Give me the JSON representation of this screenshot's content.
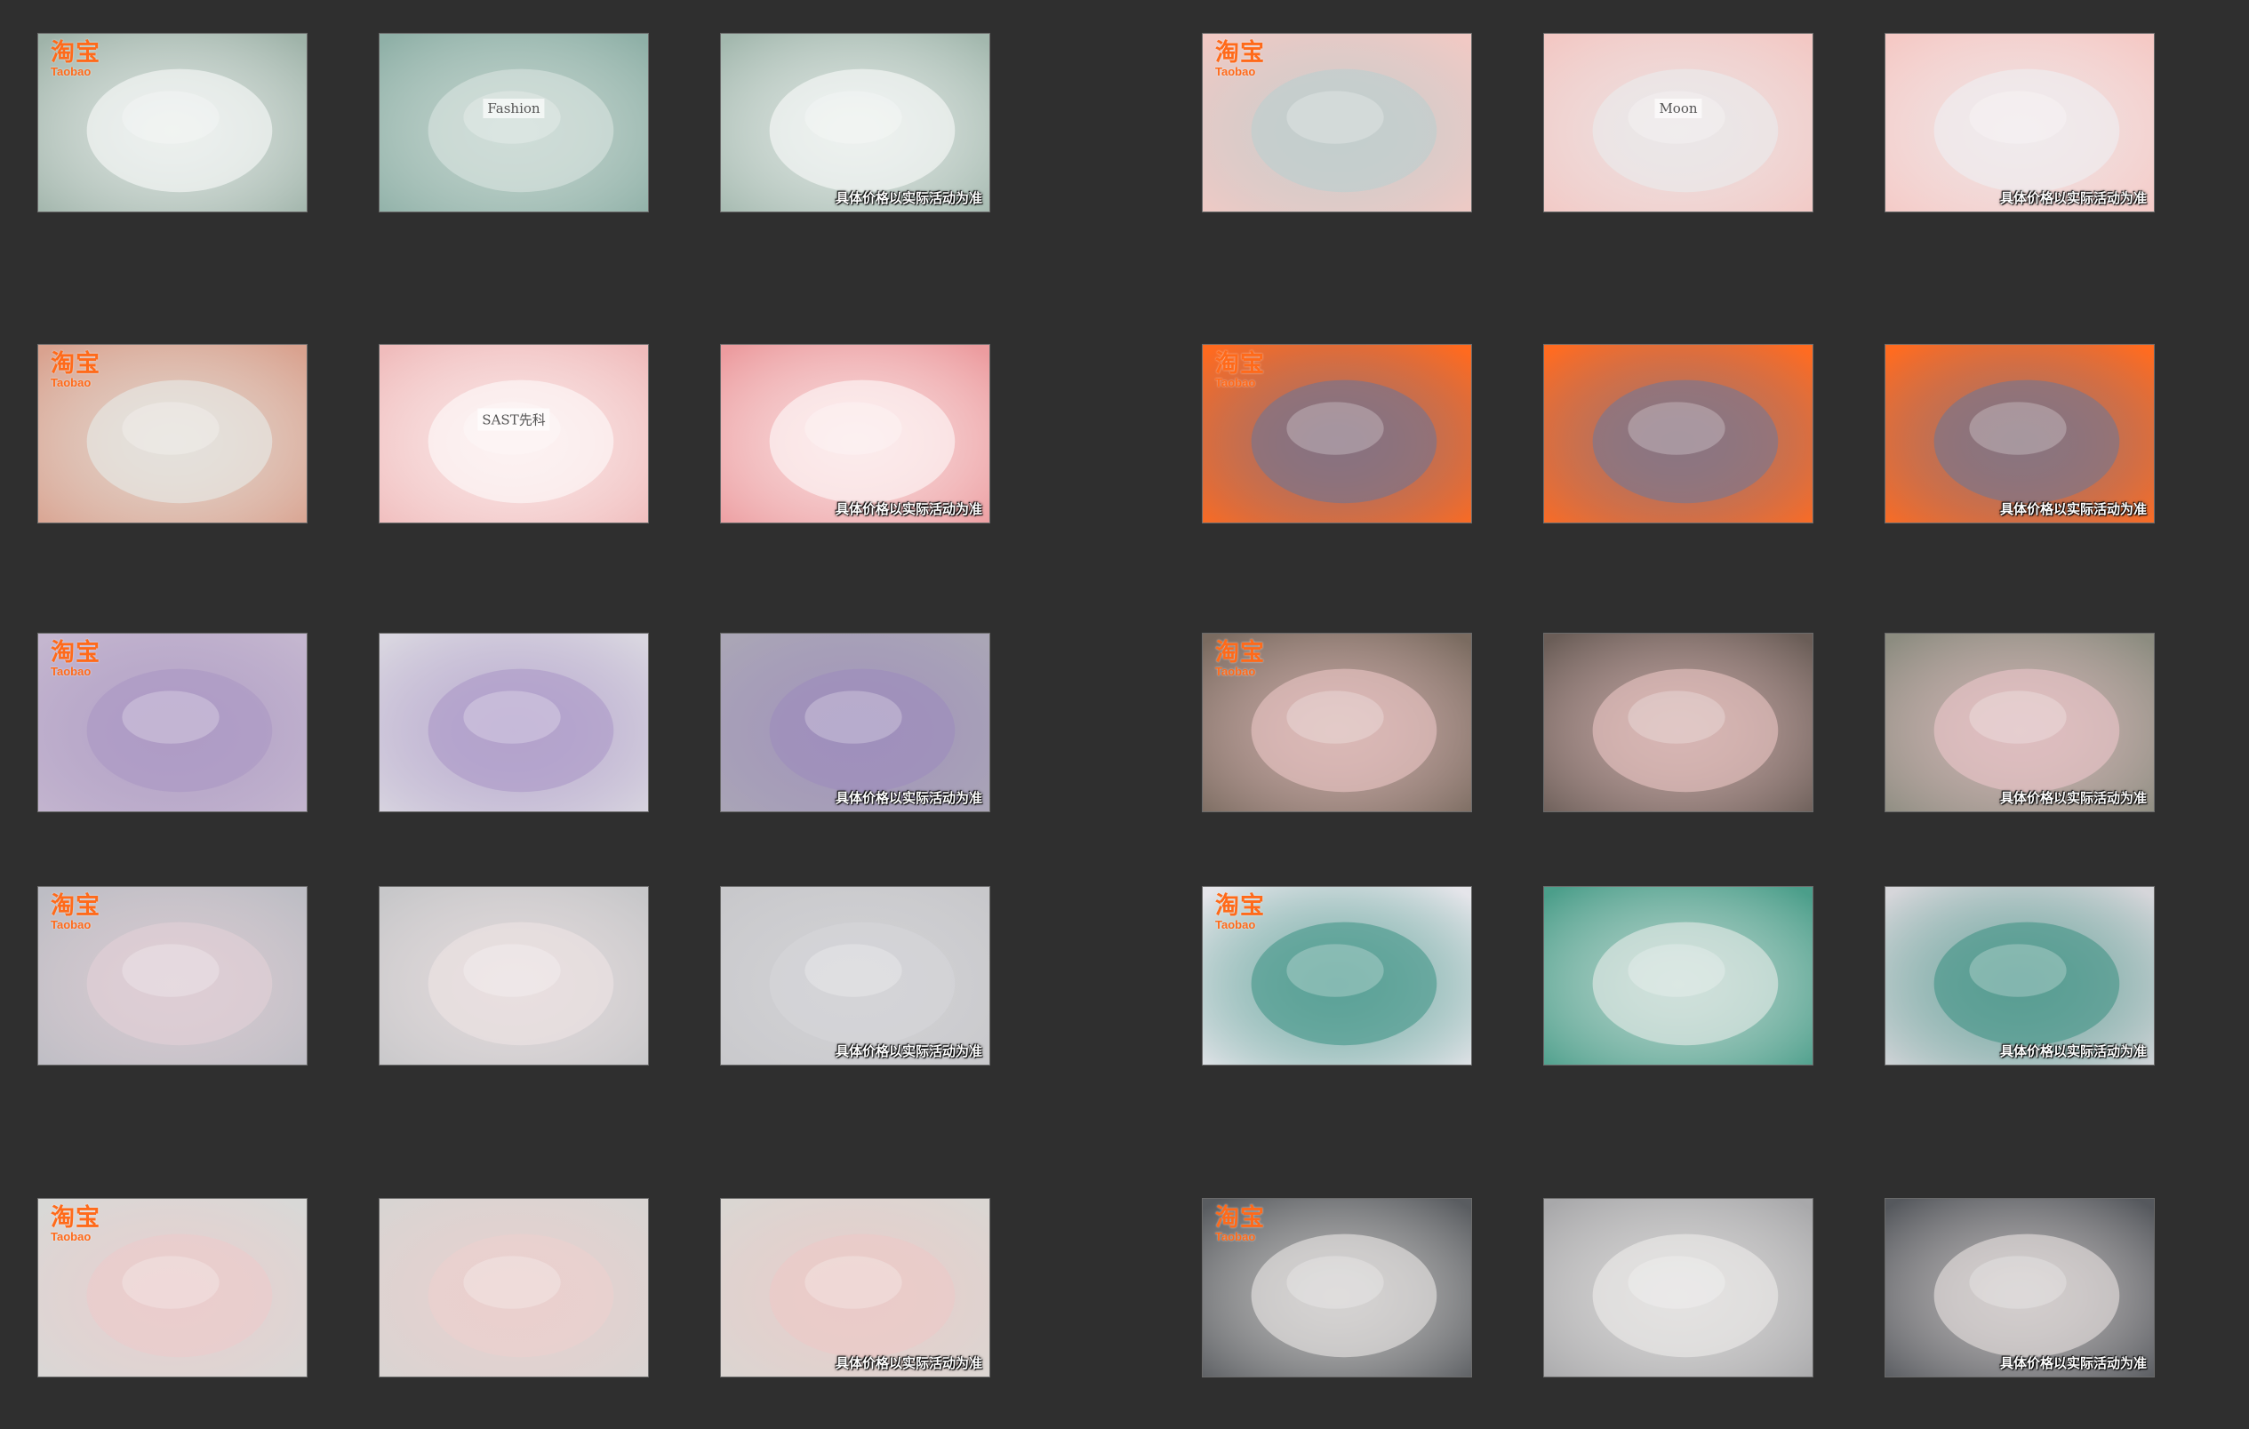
{
  "logo": {
    "cn": "淘宝",
    "en": "Taobao"
  },
  "price_note": "具体价格以实际活动为准",
  "thumbnails": [
    {
      "id": "r1c1",
      "bg": "#9fb3a9",
      "accent": "#ffffff",
      "label": "",
      "logo": true,
      "caption": false
    },
    {
      "id": "r1c2",
      "bg": "#8fb0a7",
      "accent": "#dfe8e3",
      "label": "Fashion",
      "logo": false,
      "caption": false
    },
    {
      "id": "r1c3",
      "bg": "#a3b8ae",
      "accent": "#ffffff",
      "label": "",
      "logo": false,
      "caption": true
    },
    {
      "id": "r1c4",
      "bg": "#f1c9c4",
      "accent": "#b8cfd0",
      "label": "",
      "logo": true,
      "caption": false
    },
    {
      "id": "r1c5",
      "bg": "#f3c8c4",
      "accent": "#e9eef0",
      "label": "Moon",
      "logo": false,
      "caption": false
    },
    {
      "id": "r1c6",
      "bg": "#f5c9c5",
      "accent": "#eef2f5",
      "label": "",
      "logo": false,
      "caption": true
    },
    {
      "id": "r2c1",
      "bg": "#d9a28f",
      "accent": "#e8f1ee",
      "label": "",
      "logo": true,
      "caption": false
    },
    {
      "id": "r2c2",
      "bg": "#f0bcbc",
      "accent": "#ffffff",
      "label": "SAST先科",
      "logo": false,
      "caption": false
    },
    {
      "id": "r2c3",
      "bg": "#ec9c9f",
      "accent": "#ffffff",
      "label": "",
      "logo": false,
      "caption": true
    },
    {
      "id": "r2c4",
      "bg": "#ff6a1f",
      "accent": "#6a7599",
      "label": "",
      "logo": true,
      "caption": false
    },
    {
      "id": "r2c5",
      "bg": "#ff6b21",
      "accent": "#6d789a",
      "label": "",
      "logo": false,
      "caption": false
    },
    {
      "id": "r2c6",
      "bg": "#ff6b20",
      "accent": "#6c7697",
      "label": "",
      "logo": false,
      "caption": true
    },
    {
      "id": "r3c1",
      "bg": "#c4b6cf",
      "accent": "#a996c2",
      "label": "",
      "logo": true,
      "caption": false
    },
    {
      "id": "r3c2",
      "bg": "#d9d6e0",
      "accent": "#a995c7",
      "label": "",
      "logo": false,
      "caption": false
    },
    {
      "id": "r3c3",
      "bg": "#aaa6b6",
      "accent": "#9d8bbd",
      "label": "",
      "logo": false,
      "caption": true
    },
    {
      "id": "r3c4",
      "bg": "#7a6b60",
      "accent": "#f3cccc",
      "label": "",
      "logo": true,
      "caption": false
    },
    {
      "id": "r3c5",
      "bg": "#6a5d57",
      "accent": "#f2cccb",
      "label": "",
      "logo": false,
      "caption": false
    },
    {
      "id": "r3c6",
      "bg": "#8c8c80",
      "accent": "#f3cbcf",
      "label": "",
      "logo": false,
      "caption": true
    },
    {
      "id": "r4c1",
      "bg": "#bdbdc4",
      "accent": "#e6d2d8",
      "label": "",
      "logo": true,
      "caption": false
    },
    {
      "id": "r4c2",
      "bg": "#c7c7c9",
      "accent": "#f1e5e6",
      "label": "",
      "logo": false,
      "caption": false
    },
    {
      "id": "r4c3",
      "bg": "#c8c8cb",
      "accent": "#d7d7da",
      "label": "",
      "logo": false,
      "caption": true
    },
    {
      "id": "r4c4",
      "bg": "#e5e5ea",
      "accent": "#3a9183",
      "label": "",
      "logo": true,
      "caption": false
    },
    {
      "id": "r4c5",
      "bg": "#4b9e8a",
      "accent": "#f1f1ef",
      "label": "",
      "logo": false,
      "caption": false
    },
    {
      "id": "r4c6",
      "bg": "#d6d6da",
      "accent": "#3a8f82",
      "label": "",
      "logo": false,
      "caption": true
    },
    {
      "id": "r5c1",
      "bg": "#d8d8d6",
      "accent": "#efcbcb",
      "label": "",
      "logo": true,
      "caption": false
    },
    {
      "id": "r5c2",
      "bg": "#d8d4d2",
      "accent": "#efcfcd",
      "label": "",
      "logo": false,
      "caption": false
    },
    {
      "id": "r5c3",
      "bg": "#dad6d2",
      "accent": "#eec9c7",
      "label": "",
      "logo": false,
      "caption": true
    },
    {
      "id": "r5c4",
      "bg": "#595c60",
      "accent": "#f4f1ee",
      "label": "",
      "logo": true,
      "caption": false
    },
    {
      "id": "r5c5",
      "bg": "#a8a8aa",
      "accent": "#f3f1ef",
      "label": "",
      "logo": false,
      "caption": false
    },
    {
      "id": "r5c6",
      "bg": "#55585d",
      "accent": "#f2ebe9",
      "label": "",
      "logo": false,
      "caption": true
    }
  ]
}
